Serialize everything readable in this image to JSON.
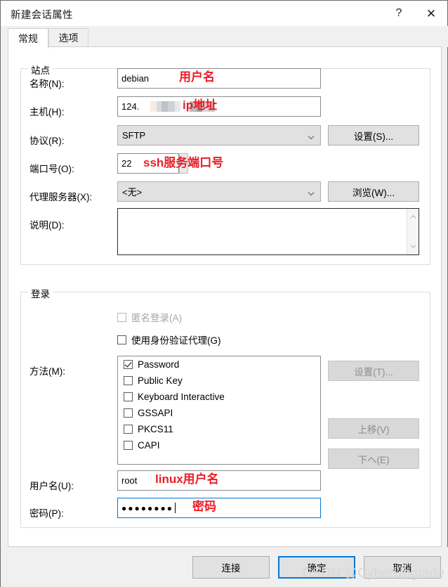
{
  "window": {
    "title": "新建会话属性",
    "help_icon": "question-mark-icon",
    "close_icon": "close-icon"
  },
  "tabs": [
    {
      "label": "常规",
      "active": true
    },
    {
      "label": "选项",
      "active": false
    }
  ],
  "site_group": {
    "title": "站点",
    "name_label": "名称(N):",
    "name_value": "debian",
    "host_label": "主机(H):",
    "host_value": "124.",
    "protocol_label": "协议(R):",
    "protocol_value": "SFTP",
    "protocol_settings_button": "设置(S)...",
    "port_label": "端口号(O):",
    "port_value": "22",
    "proxy_label": "代理服务器(X):",
    "proxy_value": "<无>",
    "proxy_browse_button": "浏览(W)...",
    "description_label": "说明(D):",
    "description_value": ""
  },
  "login_group": {
    "title": "登录",
    "anonymous_label": "匿名登录(A)",
    "anonymous_checked": false,
    "anonymous_disabled": true,
    "agent_label": "使用身份验证代理(G)",
    "agent_checked": false,
    "method_label": "方法(M):",
    "methods": [
      {
        "label": "Password",
        "checked": true
      },
      {
        "label": "Public Key",
        "checked": false
      },
      {
        "label": "Keyboard Interactive",
        "checked": false
      },
      {
        "label": "GSSAPI",
        "checked": false
      },
      {
        "label": "PKCS11",
        "checked": false
      },
      {
        "label": "CAPI",
        "checked": false
      }
    ],
    "method_settings_button": "设置(T)...",
    "move_up_button": "上移(V)",
    "move_down_button": "下へ(E)",
    "username_label": "用户名(U):",
    "username_value": "root",
    "password_label": "密码(P):",
    "password_value": "●●●●●●●●"
  },
  "footer": {
    "connect_button": "连接",
    "ok_button": "确定",
    "cancel_button": "取消"
  },
  "annotations": {
    "name": "用户名",
    "host": "ip地址",
    "port": "ssh服务端口号",
    "username": "linux用户名",
    "password": "密码"
  },
  "watermark": "CSDN @CyberUpgrade",
  "colors": {
    "accent": "#0078d7",
    "annotation": "#ee1b24",
    "dialog_bg": "#f0f0f0"
  }
}
